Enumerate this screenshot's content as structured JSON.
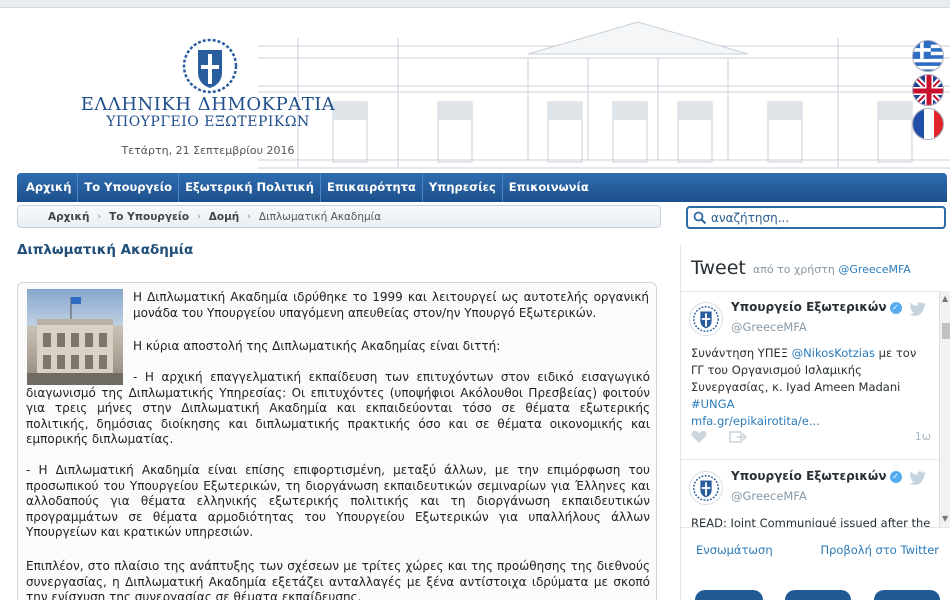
{
  "header": {
    "site_title": "ΕΛΛΗΝΙΚΗ ΔΗΜΟΚΡΑΤΙΑ",
    "site_subtitle": "ΥΠΟΥΡΓΕΙΟ ΕΞΩΤΕΡΙΚΩΝ",
    "date": "Τετάρτη, 21 Σεπτεμβρίου 2016",
    "languages": [
      "greek-flag-icon",
      "uk-flag-icon",
      "french-flag-icon"
    ]
  },
  "nav": {
    "items": [
      "Αρχική",
      "Το Υπουργείο",
      "Εξωτερική Πολιτική",
      "Επικαιρότητα",
      "Υπηρεσίες",
      "Επικοινωνία"
    ]
  },
  "breadcrumb": {
    "items": [
      "Αρχική",
      "Το Υπουργείο",
      "Δομή"
    ],
    "current": "Διπλωματική Ακαδημία"
  },
  "page": {
    "title": "Διπλωματική Ακαδημία",
    "paragraphs": [
      "Η Διπλωματική Ακαδημία ιδρύθηκε το 1999 και λειτουργεί ως αυτοτελής οργανική μονάδα του Υπουργείου υπαγόμενη απευθείας στον/ην Υπουργό Εξωτερικών.",
      "Η κύρια αποστολή της Διπλωματικής Ακαδημίας είναι διττή:",
      "- Η αρχική επαγγελματική εκπαίδευση των επιτυχόντων στον ειδικό εισαγωγικό διαγωνισμό της Διπλωματικής Υπηρεσίας: Οι επιτυχόντες (υποψήφιοι Ακόλουθοι Πρεσβείας) φοιτούν για τρεις μήνες στην Διπλωματική Ακαδημία και εκπαιδεύονται τόσο σε θέματα εξωτερικής πολιτικής, δημόσιας διοίκησης και διπλωματικής πρακτικής όσο και σε θέματα οικονομικής και εμπορικής διπλωματίας.",
      "- Η Διπλωματική Ακαδημία είναι επίσης επιφορτισμένη, μεταξύ άλλων, με την επιμόρφωση του προσωπικού του Υπουργείου Εξωτερικών, τη διοργάνωση εκπαιδευτικών σεμιναρίων για Έλληνες και αλλοδαπούς για θέματα ελληνικής εξωτερικής πολιτικής και τη διοργάνωση εκπαιδευτικών προγραμμάτων σε θέματα αρμοδιότητας του Υπουργείου Εξωτερικών για υπαλλήλους άλλων Υπουργείων και κρατικών υπηρεσιών.",
      "Επιπλέον, στο πλαίσιο της ανάπτυξης των σχέσεων με τρίτες χώρες και της προώθησης της διεθνούς συνεργασίας, η Διπλωματική Ακαδημία εξετάζει ανταλλαγές με ξένα αντίστοιχα ιδρύματα με σκοπό την ενίσχυση της συνεργασίας σε θέματα εκπαίδευσης."
    ]
  },
  "search": {
    "placeholder": "αναζήτηση..."
  },
  "twitter": {
    "title": "Tweet",
    "by_prefix": "από το χρήστη",
    "by_handle": "@GreeceMFA",
    "tweets": [
      {
        "name": "Υπουργείο Εξωτερικών",
        "handle": "@GreeceMFA",
        "text_a": "Συνάντηση ΥΠΕΞ ",
        "mention": "@NikosKotzias",
        "text_b": " με τον ΓΓ του Οργανισμού Ισλαμικής Συνεργασίας, κ. Iyad Ameen Madani ",
        "hashtag": "#UNGA",
        "link": "mfa.gr/epikairotita/e...",
        "time": "1ω"
      },
      {
        "name": "Υπουργείο Εξωτερικών",
        "handle": "@GreeceMFA",
        "text": "READ: Joint Communiqué issued after the"
      }
    ],
    "embed_label": "Ενσωμάτωση",
    "view_label": "Προβολή στο Twitter"
  },
  "colors": {
    "nav_blue": "#1c4f8c",
    "title_blue": "#1f4e79",
    "twitter_link": "#2b7bb9"
  }
}
